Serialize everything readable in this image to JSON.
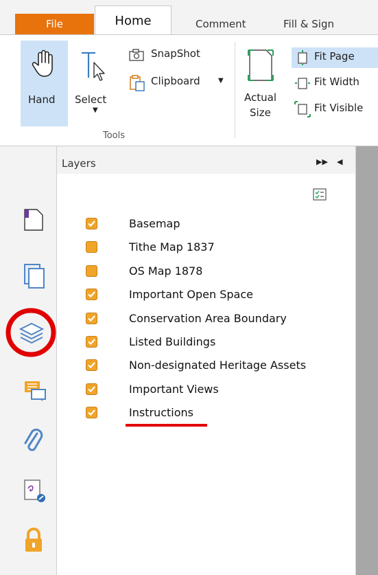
{
  "tabs": {
    "file": "File",
    "home": "Home",
    "comment": "Comment",
    "fill_sign": "Fill & Sign"
  },
  "ribbon": {
    "hand": "Hand",
    "select": "Select",
    "snapshot": "SnapShot",
    "clipboard": "Clipboard",
    "actual_size_line1": "Actual",
    "actual_size_line2": "Size",
    "fit_page": "Fit Page",
    "fit_width": "Fit Width",
    "fit_visible": "Fit Visible",
    "group_tools": "Tools"
  },
  "panel": {
    "title": "Layers"
  },
  "layers": [
    {
      "label": "Basemap",
      "checked": true
    },
    {
      "label": "Tithe Map 1837",
      "checked": false
    },
    {
      "label": "OS Map 1878",
      "checked": false
    },
    {
      "label": "Important Open Space",
      "checked": true
    },
    {
      "label": "Conservation Area Boundary",
      "checked": true
    },
    {
      "label": "Listed Buildings",
      "checked": true
    },
    {
      "label": "Non-designated Heritage Assets",
      "checked": true
    },
    {
      "label": "Important Views",
      "checked": true
    },
    {
      "label": "Instructions",
      "checked": true
    }
  ],
  "sidebar_icons": [
    "page-thumbnail-icon",
    "pages-icon",
    "layers-icon",
    "comments-icon",
    "attachment-icon",
    "signature-icon",
    "security-lock-icon"
  ],
  "colors": {
    "file_tab": "#e8720c",
    "checkbox": "#f0a42a",
    "highlight": "#cde2f6",
    "annotation": "#e10000"
  }
}
